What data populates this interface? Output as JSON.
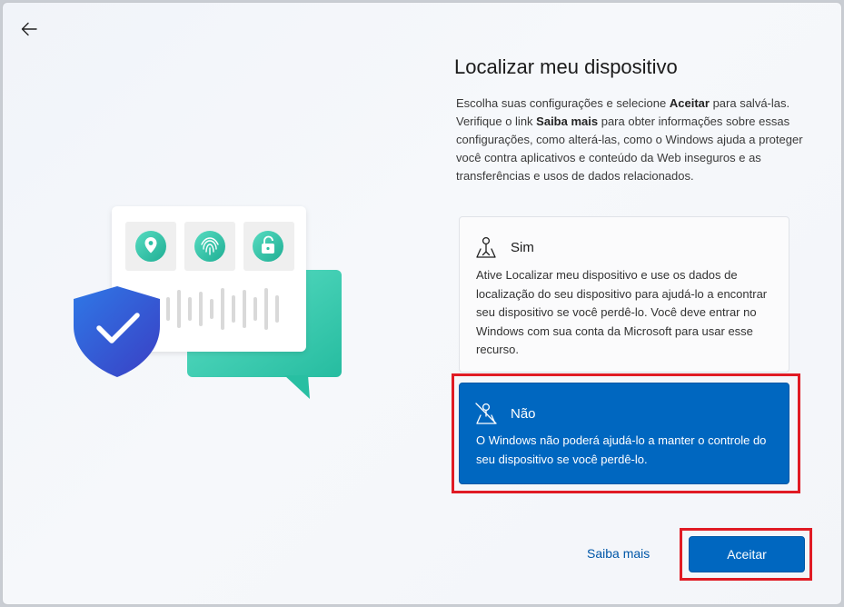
{
  "page": {
    "title": "Localizar meu dispositivo",
    "description": {
      "part1": "Escolha suas configurações e selecione ",
      "bold1": "Aceitar",
      "part2": " para salvá-las. Verifique o link ",
      "bold2": "Saiba mais",
      "part3": " para obter informações sobre essas configurações, como alterá-las, como o Windows ajuda a proteger você contra aplicativos e conteúdo da Web inseguros e as transferências e usos de dados relacionados."
    }
  },
  "nav": {
    "back_icon": "arrow-left-icon"
  },
  "illustration": {
    "icons": [
      "location-pin-icon",
      "fingerprint-icon",
      "padlock-icon",
      "shield-check-icon",
      "chat-bubble-icon",
      "voice-wave-icon"
    ]
  },
  "options": {
    "sim": {
      "icon": "person-pin-icon",
      "label": "Sim",
      "description": "Ative Localizar meu dispositivo e use os dados de localização do seu dispositivo para ajudá-lo a encontrar seu dispositivo se você perdê-lo. Você deve entrar no Windows com sua conta da Microsoft para usar esse recurso.",
      "selected": false
    },
    "nao": {
      "icon": "person-pin-off-icon",
      "label": "Não",
      "description": "O Windows não poderá ajudá-lo a manter o controle do seu dispositivo se você perdê-lo.",
      "selected": true
    }
  },
  "footer": {
    "learn_more_label": "Saiba mais",
    "accept_label": "Aceitar"
  },
  "colors": {
    "accent": "#0067c0",
    "highlight": "#e01b24",
    "teal": "#3fcfb4",
    "shield": "#2b66d9"
  }
}
